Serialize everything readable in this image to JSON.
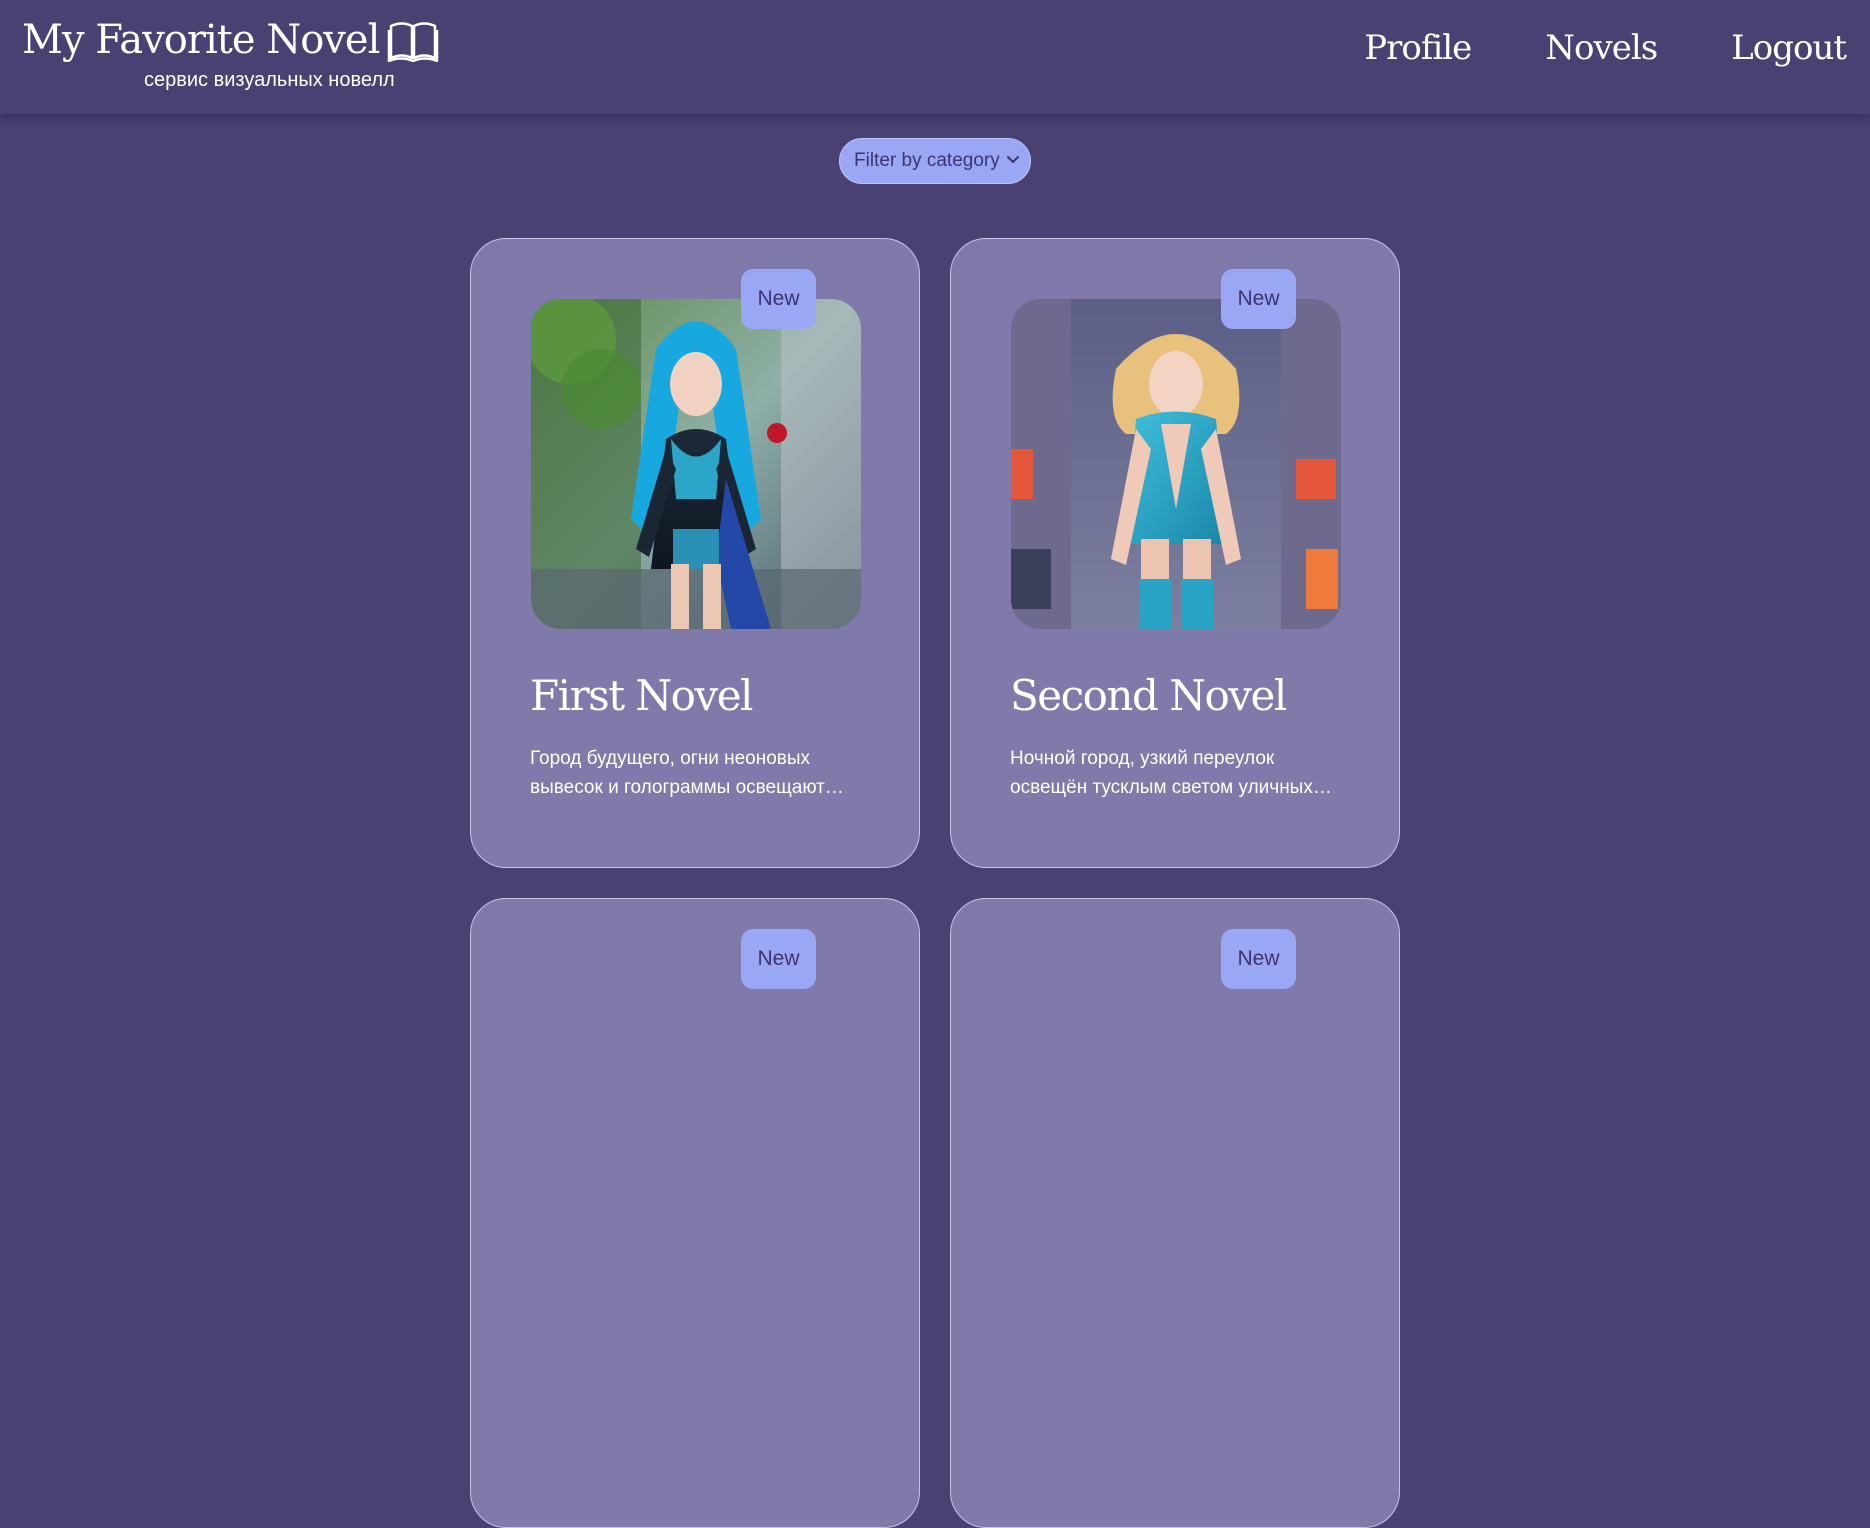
{
  "header": {
    "logo_title": "My Favorite Novel",
    "logo_subtitle": "сервис визуальных новелл",
    "nav": [
      "Profile",
      "Novels",
      "Logout"
    ]
  },
  "filter": {
    "selected": "Filter by category"
  },
  "novels": [
    {
      "badge": "New",
      "title": "First Novel",
      "description": "Город будущего, огни неоновых вывесок и голограммы освещают…"
    },
    {
      "badge": "New",
      "title": "Second Novel",
      "description": "Ночной город, узкий переулок освещён тусклым светом уличных…"
    },
    {
      "badge": "New"
    },
    {
      "badge": "New"
    }
  ],
  "colors": {
    "background": "#4a4173",
    "card": "#7f7aa9",
    "accent": "#99a7f5",
    "accent_text": "#3d3470"
  }
}
